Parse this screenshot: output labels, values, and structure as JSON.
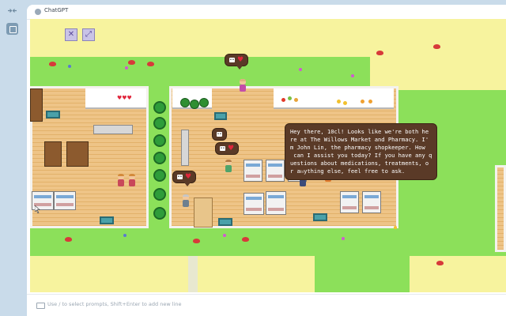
{
  "app": {
    "title": "ChatGPT"
  },
  "rail": {
    "top_icon": "arrows-icon",
    "active_icon": "window-icon"
  },
  "toolbar": {
    "mute_icon": "mute-icon",
    "collapse_icon": "collapse-icon"
  },
  "game": {
    "dialog_text": "Hey there, 10cl! Looks like we're both he\nre at The Willows Market and Pharmacy. I'\nm John Lin, the pharmacy shopkeeper. How\n can I assist you today? If you have any q\nuestions about medications, treatments, o\nr anything else, feel free to ask.",
    "hearts_label": "♥♥♥"
  },
  "footer": {
    "hint": "Use / to select prompts, Shift+Enter to add new line"
  },
  "colors": {
    "grass": "#8ce05a",
    "sand": "#f7f39e",
    "bubble": "#5a3a27",
    "rail": "#c9dbea"
  }
}
